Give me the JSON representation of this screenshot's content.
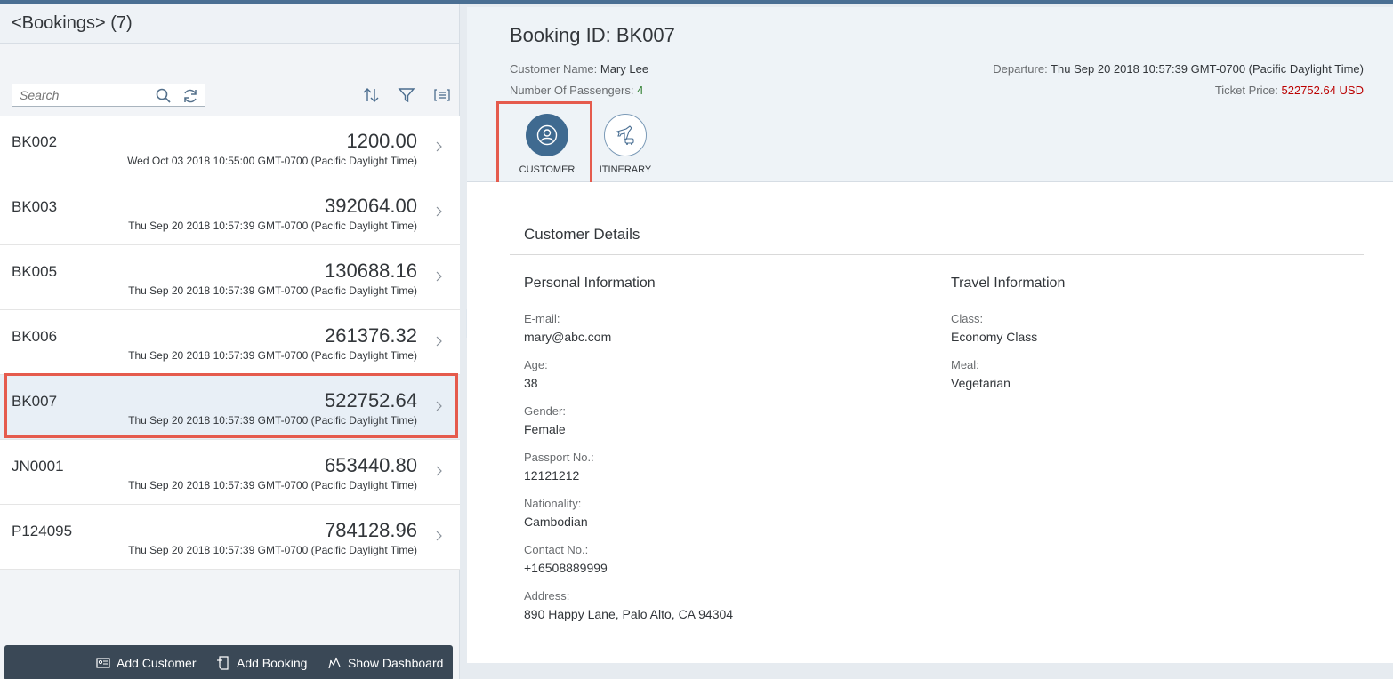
{
  "master": {
    "title": "<Bookings> (7)",
    "search_placeholder": "Search",
    "items": [
      {
        "id": "BK002",
        "amount": "1200.00",
        "date": "Wed Oct 03 2018 10:55:00 GMT-0700 (Pacific Daylight Time)"
      },
      {
        "id": "BK003",
        "amount": "392064.00",
        "date": "Thu Sep 20 2018 10:57:39 GMT-0700 (Pacific Daylight Time)"
      },
      {
        "id": "BK005",
        "amount": "130688.16",
        "date": "Thu Sep 20 2018 10:57:39 GMT-0700 (Pacific Daylight Time)"
      },
      {
        "id": "BK006",
        "amount": "261376.32",
        "date": "Thu Sep 20 2018 10:57:39 GMT-0700 (Pacific Daylight Time)"
      },
      {
        "id": "BK007",
        "amount": "522752.64",
        "date": "Thu Sep 20 2018 10:57:39 GMT-0700 (Pacific Daylight Time)"
      },
      {
        "id": "JN0001",
        "amount": "653440.80",
        "date": "Thu Sep 20 2018 10:57:39 GMT-0700 (Pacific Daylight Time)"
      },
      {
        "id": "P124095",
        "amount": "784128.96",
        "date": "Thu Sep 20 2018 10:57:39 GMT-0700 (Pacific Daylight Time)"
      }
    ],
    "footer": {
      "add_customer": "Add Customer",
      "add_booking": "Add Booking",
      "show_dashboard": "Show Dashboard"
    }
  },
  "detail": {
    "title": "Booking ID: BK007",
    "customer_name_label": "Customer Name:",
    "customer_name": "Mary Lee",
    "passengers_label": "Number Of Passengers:",
    "passengers": "4",
    "departure_label": "Departure:",
    "departure": "Thu Sep 20 2018 10:57:39 GMT-0700 (Pacific Daylight Time)",
    "price_label": "Ticket Price:",
    "price": "522752.64 USD",
    "tabs": [
      {
        "label": "CUSTOMER"
      },
      {
        "label": "ITINERARY"
      }
    ],
    "section_title": "Customer Details",
    "personal": {
      "title": "Personal Information",
      "fields": [
        {
          "label": "E-mail:",
          "value": "mary@abc.com"
        },
        {
          "label": "Age:",
          "value": "38"
        },
        {
          "label": "Gender:",
          "value": "Female"
        },
        {
          "label": "Passport No.:",
          "value": "12121212"
        },
        {
          "label": "Nationality:",
          "value": "Cambodian"
        },
        {
          "label": "Contact No.:",
          "value": "+16508889999"
        },
        {
          "label": "Address:",
          "value": "890 Happy Lane, Palo Alto, CA 94304"
        }
      ]
    },
    "travel": {
      "title": "Travel Information",
      "fields": [
        {
          "label": "Class:",
          "value": "Economy Class"
        },
        {
          "label": "Meal:",
          "value": "Vegetarian"
        }
      ]
    }
  },
  "colors": {
    "accent": "#3f6a90",
    "highlight": "#e55b4d",
    "price_red": "#bb0000",
    "passengers_green": "#2b7c2b",
    "footer_bg": "#3a4856"
  }
}
